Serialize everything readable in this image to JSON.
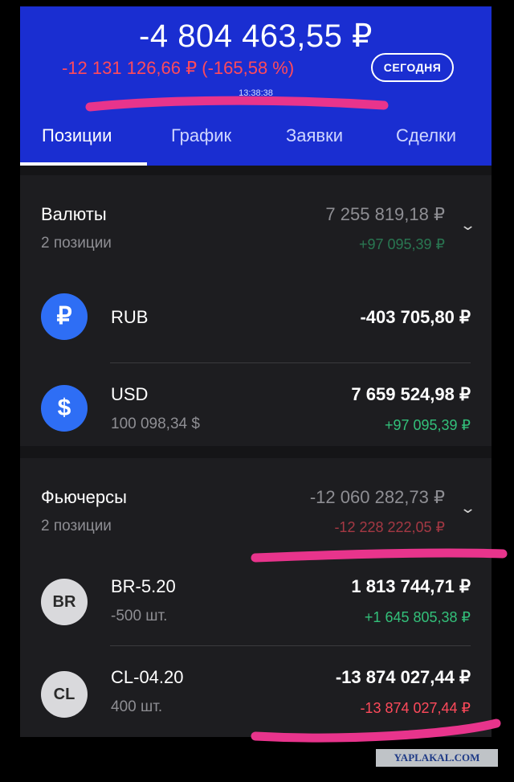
{
  "header": {
    "total": "-4 804 463,55 ₽",
    "change": "-12 131 126,66 ₽ (-165,58 %)",
    "today_button": "СЕГОДНЯ",
    "time": "13:38:38"
  },
  "tabs": [
    {
      "label": "Позиции",
      "active": true
    },
    {
      "label": "График",
      "active": false
    },
    {
      "label": "Заявки",
      "active": false
    },
    {
      "label": "Сделки",
      "active": false
    }
  ],
  "currencies": {
    "title": "Валюты",
    "subtitle": "2 позиции",
    "total": "7 255 819,18 ₽",
    "change": "+97 095,39 ₽",
    "items": [
      {
        "icon": "₽",
        "icon_name": "ruble-icon",
        "name": "RUB",
        "sub": "",
        "value": "-403 705,80 ₽",
        "change": ""
      },
      {
        "icon": "$",
        "icon_name": "dollar-icon",
        "name": "USD",
        "sub": "100 098,34 $",
        "value": "7 659 524,98 ₽",
        "change": "+97 095,39 ₽"
      }
    ]
  },
  "futures": {
    "title": "Фьючерсы",
    "subtitle": "2 позиции",
    "total": "-12 060 282,73 ₽",
    "change": "-12 228 222,05 ₽",
    "items": [
      {
        "icon": "BR",
        "name": "BR-5.20",
        "sub": "-500 шт.",
        "value": "1 813 744,71 ₽",
        "change": "+1 645 805,38 ₽"
      },
      {
        "icon": "CL",
        "name": "CL-04.20",
        "sub": "400 шт.",
        "value": "-13 874 027,44 ₽",
        "change": "-13 874 027,44 ₽"
      }
    ]
  },
  "watermark": "YAPLAKAL.COM",
  "colors": {
    "header_bg": "#1a2ed1",
    "positive": "#33c07a",
    "negative": "#ff4a5b",
    "highlight_marker": "#e8348c"
  }
}
